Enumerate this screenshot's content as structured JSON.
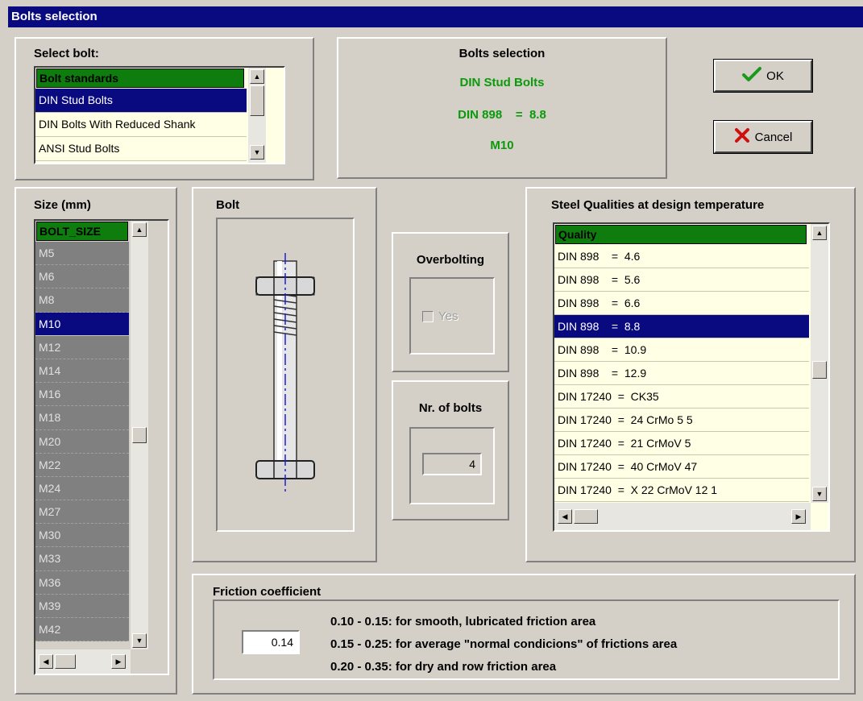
{
  "window": {
    "title": "Bolts selection"
  },
  "select_bolt": {
    "label": "Select bolt:",
    "header": "Bolt standards",
    "items": [
      "DIN Stud Bolts",
      "DIN Bolts With Reduced Shank",
      "ANSI Stud Bolts"
    ],
    "selected_index": 0
  },
  "summary": {
    "title": "Bolts selection",
    "standard": "DIN Stud Bolts",
    "quality": "DIN 898    =  8.8",
    "size": "M10"
  },
  "buttons": {
    "ok": "OK",
    "cancel": "Cancel"
  },
  "size": {
    "label": "Size (mm)",
    "header": "BOLT_SIZE",
    "items": [
      "M5",
      "M6",
      "M8",
      "M10",
      "M12",
      "M14",
      "M16",
      "M18",
      "M20",
      "M22",
      "M24",
      "M27",
      "M30",
      "M33",
      "M36",
      "M39",
      "M42"
    ],
    "selected_index": 3
  },
  "bolt": {
    "label": "Bolt"
  },
  "overbolting": {
    "label": "Overbolting",
    "checkbox_label": "Yes",
    "checked": false
  },
  "nr_bolts": {
    "label": "Nr. of bolts",
    "value": "4"
  },
  "steel": {
    "label": "Steel Qualities at design temperature",
    "header": "Quality",
    "items": [
      "DIN 898    =  4.6",
      "DIN 898    =  5.6",
      "DIN 898    =  6.6",
      "DIN 898    =  8.8",
      "DIN 898    =  10.9",
      "DIN 898    =  12.9",
      "DIN 17240  =  CK35",
      "DIN 17240  =  24 CrMo 5 5",
      "DIN 17240  =  21 CrMoV 5",
      "DIN 17240  =  40 CrMoV 47",
      "DIN 17240  =  X 22 CrMoV 12 1"
    ],
    "selected_index": 3
  },
  "friction": {
    "label": "Friction coefficient",
    "value": "0.14",
    "notes": [
      "0.10 - 0.15: for smooth, lubricated friction area",
      "0.15 - 0.25: for average \"normal condicions\" of frictions area",
      "0.20 - 0.35: for dry and row friction area"
    ]
  },
  "colors": {
    "title_bar": "#0a0a80",
    "header_green": "#0e7d0e",
    "text_green": "#0a9a0a",
    "selection": "#0a0a80",
    "list_bg": "#ffffe6"
  },
  "icons": {
    "ok": "check-icon",
    "cancel": "x-icon"
  }
}
